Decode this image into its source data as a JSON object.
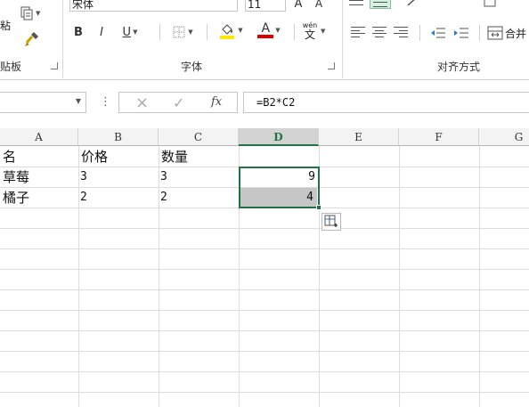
{
  "ribbon": {
    "font_name": "宋体",
    "font_size": "11",
    "clipboard": {
      "paste_label": "粘",
      "group_label": "贴板"
    },
    "font_group": {
      "bold": "B",
      "italic": "I",
      "underline": "U",
      "font_color_letter": "A",
      "phonetic_top": "wén",
      "phonetic_char": "文",
      "group_label": "字体",
      "grow_font": "A",
      "shrink_font": "A"
    },
    "alignment": {
      "group_label": "对齐方式",
      "merge_label": "合并"
    },
    "colors": {
      "highlight": "#ffe600",
      "font_color": "#e00000",
      "accent": "#217346"
    }
  },
  "formula_bar": {
    "name_box": "",
    "more_dots": "⋮",
    "cancel_icon": "×",
    "enter_icon": "✓",
    "fx_label": "fx",
    "formula": "=B2*C2"
  },
  "sheet": {
    "columns": [
      "A",
      "B",
      "C",
      "D",
      "E",
      "F",
      "G"
    ],
    "selected_column": "D",
    "rows": [
      {
        "a": "名",
        "b": "价格",
        "c": "数量",
        "d": ""
      },
      {
        "a": "草莓",
        "b": "3",
        "c": "3",
        "d": "9"
      },
      {
        "a": "橘子",
        "b": "2",
        "c": "2",
        "d": "4"
      }
    ]
  }
}
